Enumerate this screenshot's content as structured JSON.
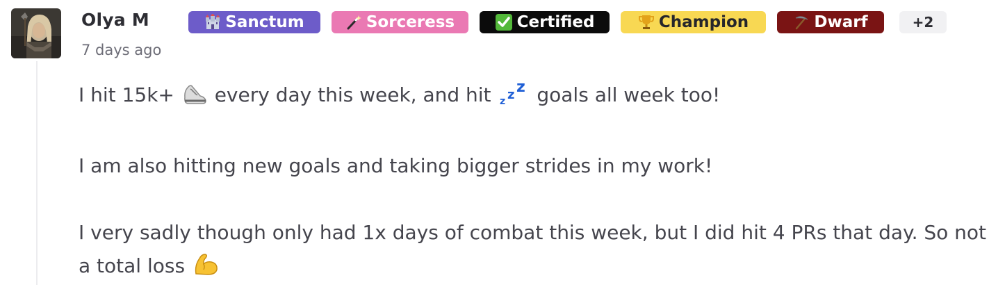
{
  "post": {
    "author": "Olya M",
    "timestamp": "7 days ago",
    "avatar_icon": "warrior-avatar",
    "badges": [
      {
        "label": "Sanctum",
        "icon": "castle-icon",
        "color": "#6d5cc9"
      },
      {
        "label": "Sorceress",
        "icon": "magic-wand-icon",
        "color": "#ea79b3"
      },
      {
        "label": "Certified",
        "icon": "check-icon",
        "color": "#0b0b0b"
      },
      {
        "label": "Champion",
        "icon": "trophy-icon",
        "color": "#f8d853"
      },
      {
        "label": "Dwarf",
        "icon": "pickaxe-icon",
        "color": "#7a1414"
      }
    ],
    "more_badges": "+2",
    "paragraph1": {
      "part1": "I hit 15k+",
      "emoji1": "sneaker-icon",
      "part2": "every day this week, and hit",
      "emoji2": "sleep-zzz-icon",
      "part3": "goals all week too!"
    },
    "paragraph2": "I am also hitting new goals and taking bigger strides in my work!",
    "paragraph3": {
      "text": "I very sadly though only had 1x days of combat this week, but I did hit 4 PRs that day. So not a total loss",
      "emoji": "flexed-biceps-icon"
    }
  }
}
